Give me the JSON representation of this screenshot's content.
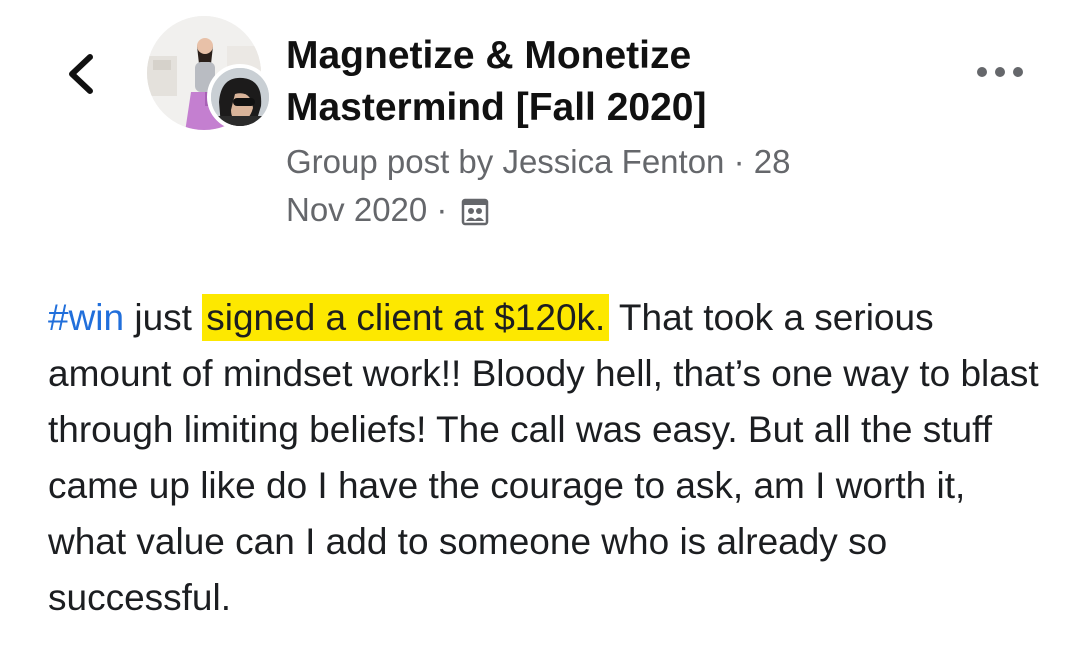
{
  "header": {
    "back_icon": "chevron-left-icon",
    "group_name_line1": "Magnetize & Monetize",
    "group_name_line2": "Mastermind [Fall 2020]",
    "meta": {
      "prefix": "Group post by ",
      "author": "Jessica Fenton",
      "separator": " · ",
      "date_line1": "28",
      "date_line2": "Nov 2020",
      "privacy_icon": "members-group-icon"
    },
    "more_icon": "more-options-icon"
  },
  "post": {
    "hashtag": "#win",
    "text_before_highlight": " just ",
    "highlighted_text": "signed a client at $120k.",
    "text_after_highlight": " That took a serious amount of mindset work!! Bloody hell, that’s one way to blast through limiting beliefs! The call was easy. But all the stuff came up like do I have the courage to ask, am I worth it, what value can I add to someone who is already so successful."
  },
  "colors": {
    "hashtag": "#216fdb",
    "highlight": "#fde800",
    "meta_text": "#65676b",
    "body_text": "#1c1e21"
  }
}
